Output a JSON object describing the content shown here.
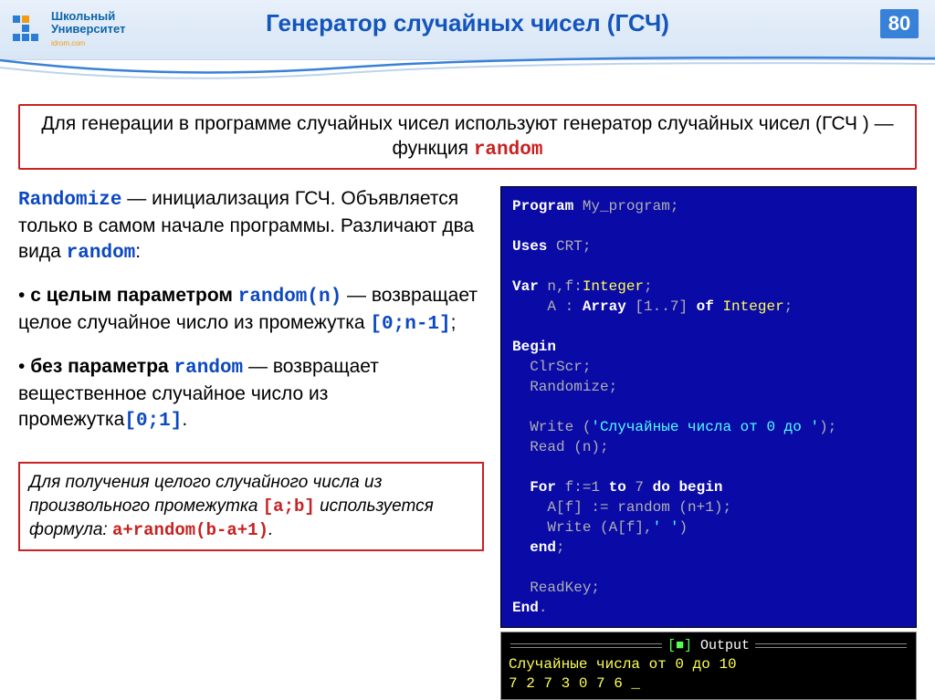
{
  "header": {
    "logo_line1": "Школьный",
    "logo_line2": "Университет",
    "logo_sub": "idrom.com",
    "title": "Генератор случайных чисел  (ГСЧ)",
    "page_number": "80"
  },
  "intro": {
    "text1": "Для генерации в программе случайных чисел используют генератор случайных чисел (ГСЧ ) — функция ",
    "code": "random"
  },
  "left": {
    "p1_code": "Randomize",
    "p1_rest": "  —   инициализация ГСЧ. Объявляется только в самом начале программы. Различают два вида ",
    "p1_code2": "random",
    "p1_end": ":",
    "p2_bullet": "• ",
    "p2_bold": "с целым параметром ",
    "p2_code": "random(n)",
    "p2_rest": " — возвращает целое случайное число из промежутка ",
    "p2_range": "[0;n-1]",
    "p2_semi": ";",
    "p3_bullet": "• ",
    "p3_bold": "без параметра ",
    "p3_code": "random",
    "p3_rest": " — возвращает вещественное случайное число из промежутка",
    "p3_range": "[0;1]",
    "p3_dot": ".",
    "formula_text1": "Для получения целого случайного числа из произвольного промежутка ",
    "formula_range": "[a;b]",
    "formula_text2": " используется формула: ",
    "formula_code": "a+random(b-a+1)",
    "formula_dot": "."
  },
  "code": {
    "l1a": "Program",
    "l1b": " My_program;",
    "l2a": "Uses",
    "l2b": " CRT;",
    "l3a": "Var",
    "l3b": " n,f:",
    "l3c": "Integer",
    "l3d": ";",
    "l4a": "    A : ",
    "l4b": "Array",
    "l4c": " [1..7] ",
    "l4d": "of",
    "l4e": " ",
    "l4f": "Integer",
    "l4g": ";",
    "l5": "Begin",
    "l6": "  ClrScr;",
    "l7": "  Randomize;",
    "l8a": "  Write (",
    "l8b": "'Случайные числа от 0 до '",
    "l8c": ");",
    "l9": "  Read (n);",
    "l10a": "  ",
    "l10b": "For",
    "l10c": " f:=1 ",
    "l10d": "to",
    "l10e": " 7 ",
    "l10f": "do",
    "l10g": " ",
    "l10h": "begin",
    "l11": "    A[f] := random (n+1);",
    "l12a": "    Write (A[f],",
    "l12b": "' '",
    "l12c": ")",
    "l13a": "  ",
    "l13b": "end",
    "l13c": ";",
    "l14": "  ReadKey;",
    "l15a": "End",
    "l15b": "."
  },
  "output": {
    "title_sq": "[■]",
    "title": " Output ",
    "line1": "Случайные числа от 0 до 10",
    "line2": "7 2 7 3 0 7 6 _"
  }
}
